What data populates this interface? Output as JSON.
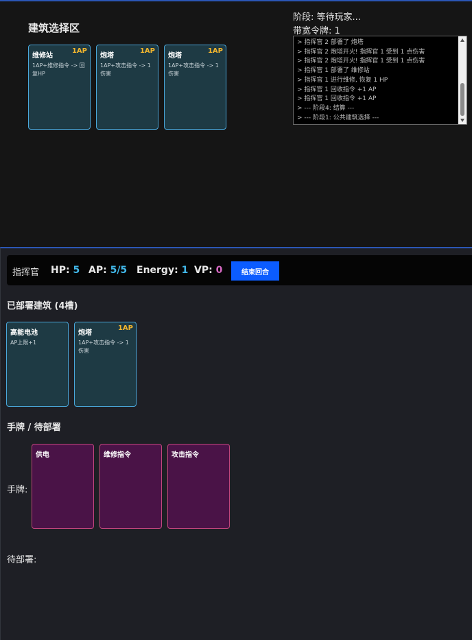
{
  "building_select": {
    "title": "建筑选择区",
    "cards": [
      {
        "name": "维修站",
        "cost": "1AP",
        "desc": "1AP+维修指令 -> 回复HP"
      },
      {
        "name": "炮塔",
        "cost": "1AP",
        "desc": "1AP+攻击指令 -> 1伤害"
      },
      {
        "name": "炮塔",
        "cost": "1AP",
        "desc": "1AP+攻击指令 -> 1伤害"
      }
    ]
  },
  "status": {
    "phase": "阶段: 等待玩家...",
    "bandwidth": "带宽令牌: 1"
  },
  "log": [
    "> 指挥官 2 部署了 炮塔",
    "> 指挥官 2 炮塔开火! 指挥官 1 受到 1 点伤害",
    "> 指挥官 2 炮塔开火! 指挥官 1 受到 1 点伤害",
    "> 指挥官 1 部署了 维修站",
    "> 指挥官 1 进行维修, 恢复 1 HP",
    "> 指挥官 1 回收指令 +1 AP",
    "> 指挥官 1 回收指令 +1 AP",
    "> --- 阶段4: 结算 ---",
    "> --- 阶段1: 公共建筑选择 ---"
  ],
  "player": {
    "title": "指挥官",
    "hp_label": "HP:",
    "hp": "5",
    "ap_label": "AP:",
    "ap": "5/5",
    "energy_label": "Energy:",
    "energy": "1",
    "vp_label": "VP:",
    "vp": "0",
    "end_turn": "结束回合"
  },
  "deployed": {
    "title": "已部署建筑 (4槽)",
    "cards": [
      {
        "name": "高能电池",
        "cost": "",
        "desc": "AP上限+1"
      },
      {
        "name": "炮塔",
        "cost": "1AP",
        "desc": "1AP+攻击指令 -> 1伤害"
      }
    ]
  },
  "hand": {
    "title": "手牌 / 待部署",
    "label": "手牌:",
    "cards": [
      {
        "name": "供电"
      },
      {
        "name": "维修指令"
      },
      {
        "name": "攻击指令"
      }
    ],
    "pending_label": "待部署:"
  },
  "colors": {
    "accent_blue": "#0b5cff",
    "value_blue": "#41b7e8",
    "value_pink": "#d569c2",
    "cost_gold": "#f1b52e",
    "building_border": "#4aa8dc",
    "hand_border": "#c0467c"
  }
}
